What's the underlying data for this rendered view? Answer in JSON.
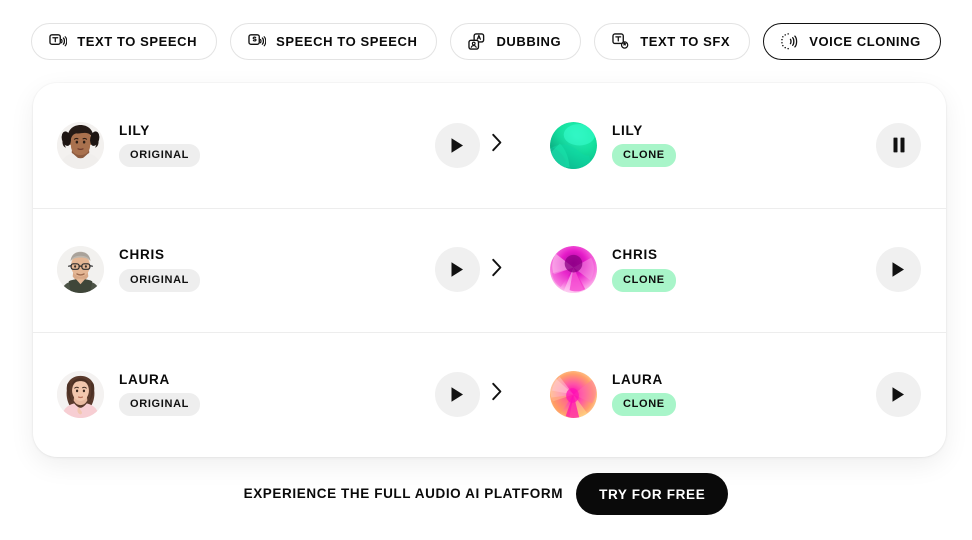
{
  "tabs": [
    {
      "label": "TEXT TO SPEECH",
      "icon": "text-to-speech-icon",
      "active": false
    },
    {
      "label": "SPEECH TO SPEECH",
      "icon": "speech-to-speech-icon",
      "active": false
    },
    {
      "label": "DUBBING",
      "icon": "dubbing-icon",
      "active": false
    },
    {
      "label": "TEXT TO SFX",
      "icon": "text-to-sfx-icon",
      "active": false
    },
    {
      "label": "VOICE CLONING",
      "icon": "voice-cloning-icon",
      "active": true
    }
  ],
  "rows": [
    {
      "original": {
        "name": "LILY",
        "badge": "ORIGINAL",
        "avatar": "photo-lily"
      },
      "clone": {
        "name": "LILY",
        "badge": "CLONE",
        "avatar": "gradient-green"
      },
      "original_player": {
        "state": "play",
        "icon": "play-icon"
      },
      "clone_player": {
        "state": "pause",
        "icon": "pause-icon"
      },
      "separator_icon": "chevron-right-icon"
    },
    {
      "original": {
        "name": "CHRIS",
        "badge": "ORIGINAL",
        "avatar": "photo-chris"
      },
      "clone": {
        "name": "CHRIS",
        "badge": "CLONE",
        "avatar": "gradient-magenta"
      },
      "original_player": {
        "state": "play",
        "icon": "play-icon"
      },
      "clone_player": {
        "state": "play",
        "icon": "play-icon"
      },
      "separator_icon": "chevron-right-icon"
    },
    {
      "original": {
        "name": "LAURA",
        "badge": "ORIGINAL",
        "avatar": "photo-laura"
      },
      "clone": {
        "name": "LAURA",
        "badge": "CLONE",
        "avatar": "gradient-pink"
      },
      "original_player": {
        "state": "play",
        "icon": "play-icon"
      },
      "clone_player": {
        "state": "play",
        "icon": "play-icon"
      },
      "separator_icon": "chevron-right-icon"
    }
  ],
  "footer": {
    "text": "EXPERIENCE THE FULL AUDIO AI PLATFORM",
    "cta_label": "TRY FOR FREE"
  },
  "colors": {
    "clone_badge_bg": "#a8f5c9",
    "original_badge_bg": "#eeeeee",
    "cta_bg": "#0a0a0a",
    "button_bg": "#f0f0f0",
    "active_tab_border": "#111111"
  }
}
